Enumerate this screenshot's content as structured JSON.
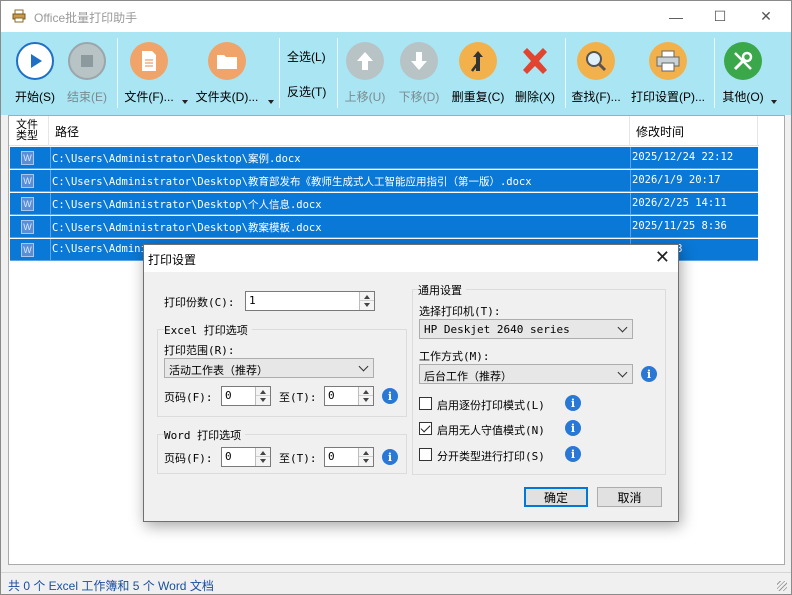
{
  "window": {
    "title": "Office批量打印助手",
    "minimize": "—",
    "maximize": "☐",
    "close": "✕"
  },
  "toolbar": {
    "start": "开始(S)",
    "stop": "结束(E)",
    "file": "文件(F)...",
    "folder": "文件夹(D)...",
    "select_all": "全选(L)",
    "invert": "反选(T)",
    "move_up": "上移(U)",
    "move_down": "下移(D)",
    "remove_dup": "删重复(C)",
    "delete": "删除(X)",
    "find": "查找(F)...",
    "print_settings": "打印设置(P)...",
    "other": "其他(O)"
  },
  "list": {
    "columns": {
      "type": "文件\n类型",
      "path": "路径",
      "modified": "修改时间"
    },
    "rows": [
      {
        "type_icon": "W",
        "path": "C:\\Users\\Administrator\\Desktop\\案例.docx",
        "modified": "2025/12/24 22:12"
      },
      {
        "type_icon": "W",
        "path": "C:\\Users\\Administrator\\Desktop\\教育部发布《教师生成式人工智能应用指引（第一版）.docx",
        "modified": "2026/1/9 20:17"
      },
      {
        "type_icon": "W",
        "path": "C:\\Users\\Administrator\\Desktop\\个人信息.docx",
        "modified": "2026/2/25 14:11"
      },
      {
        "type_icon": "W",
        "path": "C:\\Users\\Administrator\\Desktop\\教案模板.docx",
        "modified": "2025/11/25 8:36"
      },
      {
        "type_icon": "W",
        "path": "C:\\Users\\Admini",
        "modified": "29 17:33"
      }
    ]
  },
  "status": {
    "text": "共 0 个 Excel 工作簿和 5 个 Word 文档"
  },
  "dialog": {
    "title": "打印设置",
    "copies_label": "打印份数(C):",
    "copies_value": "1",
    "excel_group": "Excel 打印选项",
    "excel_range_label": "打印范围(R):",
    "excel_range_value": "活动工作表（推荐）",
    "excel_page_label": "页码(F):",
    "excel_page_from": "0",
    "excel_to_label": "至(T):",
    "excel_page_to": "0",
    "word_group": "Word 打印选项",
    "word_page_label": "页码(F):",
    "word_page_from": "0",
    "word_to_label": "至(T):",
    "word_page_to": "0",
    "general_group": "通用设置",
    "printer_label": "选择打印机(T):",
    "printer_value": "HP Deskjet 2640 series",
    "mode_label": "工作方式(M):",
    "mode_value": "后台工作（推荐）",
    "collate_label": "启用逐份打印模式(L)",
    "collate_checked": false,
    "unattended_label": "启用无人守值模式(N)",
    "unattended_checked": true,
    "by_type_label": "分开类型进行打印(S)",
    "by_type_checked": false,
    "ok": "确定",
    "cancel": "取消",
    "info_glyph": "i"
  },
  "colors": {
    "toolbar_bg": "#a9e5f3",
    "selection": "#0a78d7",
    "status_text": "#1a4fa0"
  }
}
